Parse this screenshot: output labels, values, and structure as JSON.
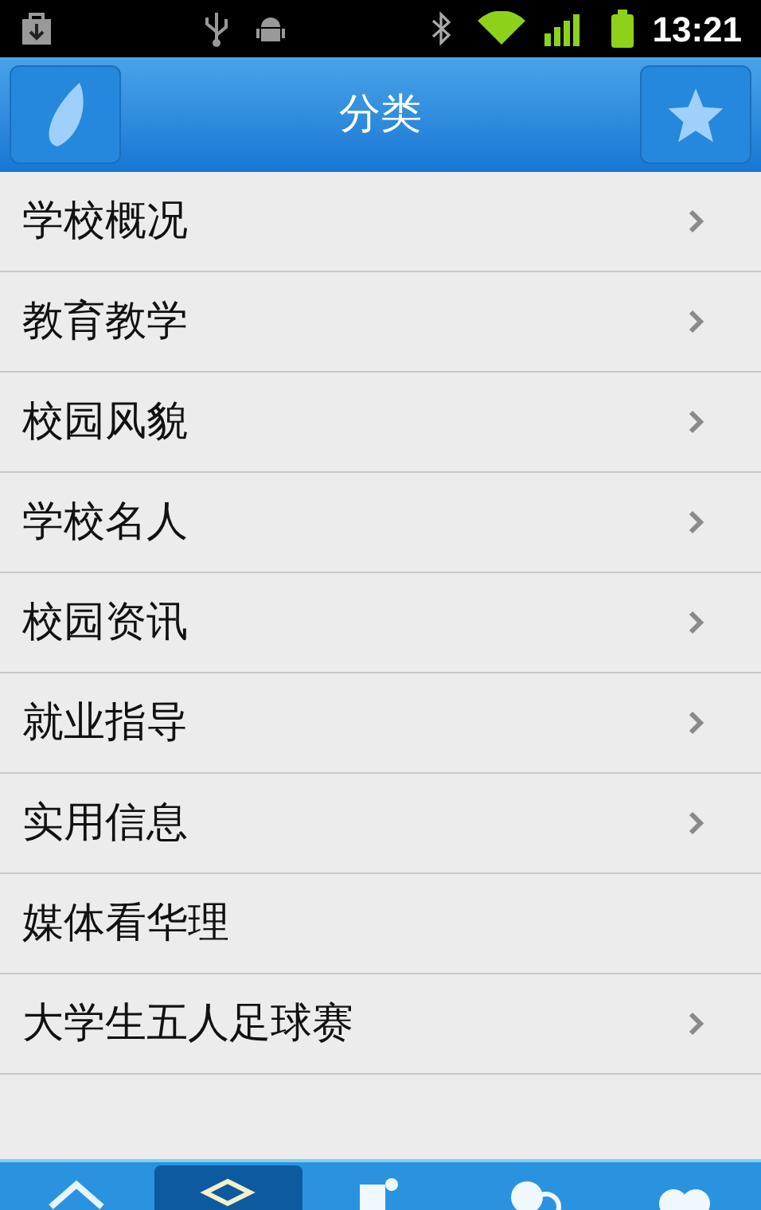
{
  "status_bar": {
    "time": "13:21"
  },
  "header": {
    "title": "分类"
  },
  "items": [
    {
      "label": "学校概况",
      "has_arrow": true
    },
    {
      "label": "教育教学",
      "has_arrow": true
    },
    {
      "label": "校园风貌",
      "has_arrow": true
    },
    {
      "label": "学校名人",
      "has_arrow": true
    },
    {
      "label": "校园资讯",
      "has_arrow": true
    },
    {
      "label": "就业指导",
      "has_arrow": true
    },
    {
      "label": "实用信息",
      "has_arrow": true
    },
    {
      "label": "媒体看华理",
      "has_arrow": false
    },
    {
      "label": "大学生五人足球赛",
      "has_arrow": true
    }
  ],
  "tab_bar": [
    {
      "kind": "home",
      "selected": false
    },
    {
      "kind": "layers",
      "selected": true
    },
    {
      "kind": "news",
      "selected": false
    },
    {
      "kind": "chat",
      "selected": false
    },
    {
      "kind": "heart",
      "selected": false
    }
  ]
}
